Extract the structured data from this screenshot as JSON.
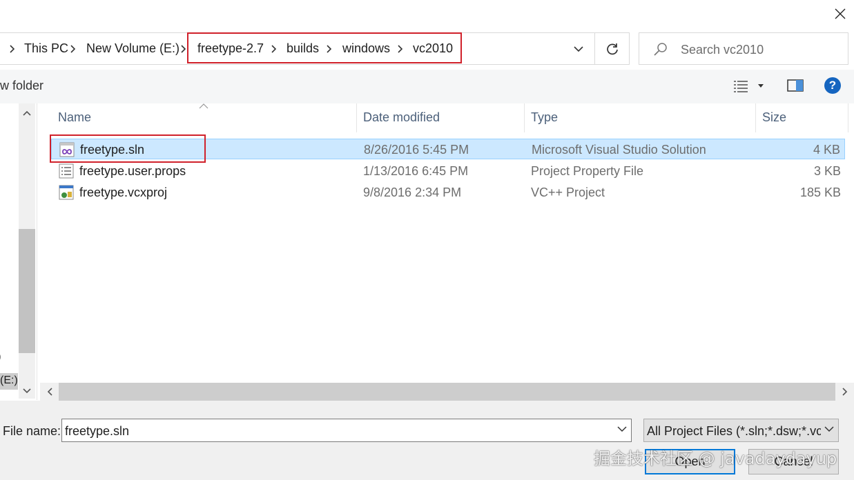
{
  "window": {
    "close_icon": "close-icon"
  },
  "address_bar": {
    "crumbs": [
      "This PC",
      "New Volume (E:)",
      "freetype-2.7",
      "builds",
      "windows",
      "vc2010"
    ]
  },
  "search": {
    "placeholder": "Search vc2010"
  },
  "toolbar": {
    "new_folder_label": "w folder",
    "help_label": "?"
  },
  "left_pane": {
    "items": [
      ")",
      "(E:)"
    ]
  },
  "columns": {
    "name": "Name",
    "date": "Date modified",
    "type": "Type",
    "size": "Size"
  },
  "files": [
    {
      "name": "freetype.sln",
      "date": "8/26/2016 5:45 PM",
      "type": "Microsoft Visual Studio Solution",
      "size": "4 KB",
      "icon": "vs-solution-icon",
      "selected": true
    },
    {
      "name": "freetype.user.props",
      "date": "1/13/2016 6:45 PM",
      "type": "Project Property File",
      "size": "3 KB",
      "icon": "property-file-icon",
      "selected": false
    },
    {
      "name": "freetype.vcxproj",
      "date": "9/8/2016 2:34 PM",
      "type": "VC++ Project",
      "size": "185 KB",
      "icon": "vcxproj-icon",
      "selected": false
    }
  ],
  "bottom": {
    "file_name_label": "File name:",
    "file_name_value": "freetype.sln",
    "filter_value": "All Project Files (*.sln;*.dsw;*.vcw",
    "open_label": "Open",
    "cancel_label": "Cancel"
  },
  "watermark": "掘金技术社区 @ javadaydayup",
  "colors": {
    "accent": "#0078d7",
    "selection": "#cce8ff",
    "highlight_box": "#d0202a"
  }
}
